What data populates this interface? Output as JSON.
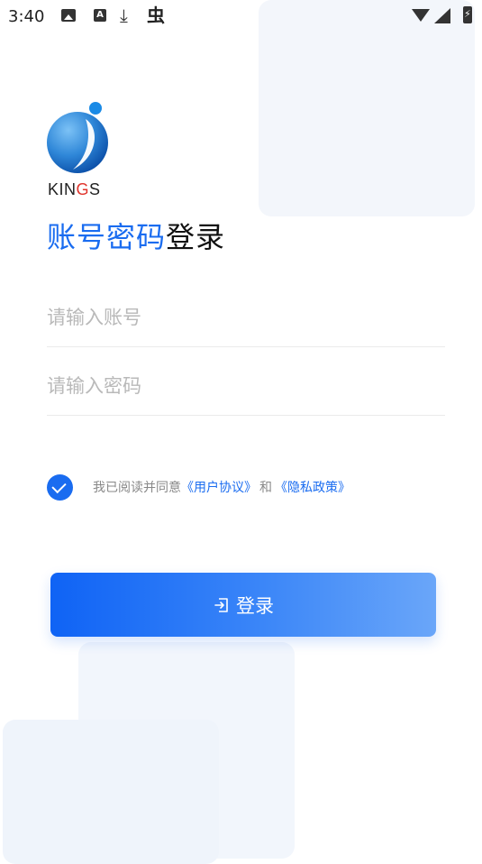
{
  "status_bar": {
    "time": "3:40",
    "icons": [
      "image-icon",
      "a-icon",
      "download-icon",
      "bug-icon",
      "wifi-icon",
      "signal-icon",
      "battery-icon"
    ]
  },
  "logo": {
    "text_prefix": "K",
    "text_main": "IN",
    "text_accent": "G",
    "text_suffix": "S"
  },
  "title": {
    "highlight": "账号密码",
    "rest": "登录"
  },
  "form": {
    "account_placeholder": "请输入账号",
    "account_value": "",
    "password_placeholder": "请输入密码",
    "password_value": ""
  },
  "agreement": {
    "checked": true,
    "prefix": "我已阅读并同意",
    "user_agreement": "《用户协议》",
    "and": "和",
    "privacy_policy": "《隐私政策》"
  },
  "login_button": {
    "label": "登录"
  },
  "colors": {
    "accent": "#1a6cf0",
    "logo_red": "#e0332b",
    "placeholder": "#b9b9b9"
  }
}
